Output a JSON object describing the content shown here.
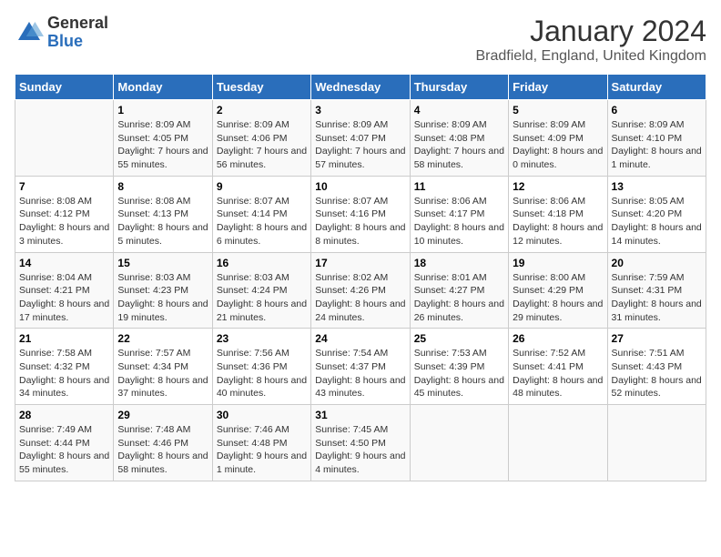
{
  "logo": {
    "general": "General",
    "blue": "Blue"
  },
  "title": "January 2024",
  "location": "Bradfield, England, United Kingdom",
  "days_of_week": [
    "Sunday",
    "Monday",
    "Tuesday",
    "Wednesday",
    "Thursday",
    "Friday",
    "Saturday"
  ],
  "weeks": [
    [
      {
        "day": "",
        "sunrise": "",
        "sunset": "",
        "daylight": ""
      },
      {
        "day": "1",
        "sunrise": "Sunrise: 8:09 AM",
        "sunset": "Sunset: 4:05 PM",
        "daylight": "Daylight: 7 hours and 55 minutes."
      },
      {
        "day": "2",
        "sunrise": "Sunrise: 8:09 AM",
        "sunset": "Sunset: 4:06 PM",
        "daylight": "Daylight: 7 hours and 56 minutes."
      },
      {
        "day": "3",
        "sunrise": "Sunrise: 8:09 AM",
        "sunset": "Sunset: 4:07 PM",
        "daylight": "Daylight: 7 hours and 57 minutes."
      },
      {
        "day": "4",
        "sunrise": "Sunrise: 8:09 AM",
        "sunset": "Sunset: 4:08 PM",
        "daylight": "Daylight: 7 hours and 58 minutes."
      },
      {
        "day": "5",
        "sunrise": "Sunrise: 8:09 AM",
        "sunset": "Sunset: 4:09 PM",
        "daylight": "Daylight: 8 hours and 0 minutes."
      },
      {
        "day": "6",
        "sunrise": "Sunrise: 8:09 AM",
        "sunset": "Sunset: 4:10 PM",
        "daylight": "Daylight: 8 hours and 1 minute."
      }
    ],
    [
      {
        "day": "7",
        "sunrise": "Sunrise: 8:08 AM",
        "sunset": "Sunset: 4:12 PM",
        "daylight": "Daylight: 8 hours and 3 minutes."
      },
      {
        "day": "8",
        "sunrise": "Sunrise: 8:08 AM",
        "sunset": "Sunset: 4:13 PM",
        "daylight": "Daylight: 8 hours and 5 minutes."
      },
      {
        "day": "9",
        "sunrise": "Sunrise: 8:07 AM",
        "sunset": "Sunset: 4:14 PM",
        "daylight": "Daylight: 8 hours and 6 minutes."
      },
      {
        "day": "10",
        "sunrise": "Sunrise: 8:07 AM",
        "sunset": "Sunset: 4:16 PM",
        "daylight": "Daylight: 8 hours and 8 minutes."
      },
      {
        "day": "11",
        "sunrise": "Sunrise: 8:06 AM",
        "sunset": "Sunset: 4:17 PM",
        "daylight": "Daylight: 8 hours and 10 minutes."
      },
      {
        "day": "12",
        "sunrise": "Sunrise: 8:06 AM",
        "sunset": "Sunset: 4:18 PM",
        "daylight": "Daylight: 8 hours and 12 minutes."
      },
      {
        "day": "13",
        "sunrise": "Sunrise: 8:05 AM",
        "sunset": "Sunset: 4:20 PM",
        "daylight": "Daylight: 8 hours and 14 minutes."
      }
    ],
    [
      {
        "day": "14",
        "sunrise": "Sunrise: 8:04 AM",
        "sunset": "Sunset: 4:21 PM",
        "daylight": "Daylight: 8 hours and 17 minutes."
      },
      {
        "day": "15",
        "sunrise": "Sunrise: 8:03 AM",
        "sunset": "Sunset: 4:23 PM",
        "daylight": "Daylight: 8 hours and 19 minutes."
      },
      {
        "day": "16",
        "sunrise": "Sunrise: 8:03 AM",
        "sunset": "Sunset: 4:24 PM",
        "daylight": "Daylight: 8 hours and 21 minutes."
      },
      {
        "day": "17",
        "sunrise": "Sunrise: 8:02 AM",
        "sunset": "Sunset: 4:26 PM",
        "daylight": "Daylight: 8 hours and 24 minutes."
      },
      {
        "day": "18",
        "sunrise": "Sunrise: 8:01 AM",
        "sunset": "Sunset: 4:27 PM",
        "daylight": "Daylight: 8 hours and 26 minutes."
      },
      {
        "day": "19",
        "sunrise": "Sunrise: 8:00 AM",
        "sunset": "Sunset: 4:29 PM",
        "daylight": "Daylight: 8 hours and 29 minutes."
      },
      {
        "day": "20",
        "sunrise": "Sunrise: 7:59 AM",
        "sunset": "Sunset: 4:31 PM",
        "daylight": "Daylight: 8 hours and 31 minutes."
      }
    ],
    [
      {
        "day": "21",
        "sunrise": "Sunrise: 7:58 AM",
        "sunset": "Sunset: 4:32 PM",
        "daylight": "Daylight: 8 hours and 34 minutes."
      },
      {
        "day": "22",
        "sunrise": "Sunrise: 7:57 AM",
        "sunset": "Sunset: 4:34 PM",
        "daylight": "Daylight: 8 hours and 37 minutes."
      },
      {
        "day": "23",
        "sunrise": "Sunrise: 7:56 AM",
        "sunset": "Sunset: 4:36 PM",
        "daylight": "Daylight: 8 hours and 40 minutes."
      },
      {
        "day": "24",
        "sunrise": "Sunrise: 7:54 AM",
        "sunset": "Sunset: 4:37 PM",
        "daylight": "Daylight: 8 hours and 43 minutes."
      },
      {
        "day": "25",
        "sunrise": "Sunrise: 7:53 AM",
        "sunset": "Sunset: 4:39 PM",
        "daylight": "Daylight: 8 hours and 45 minutes."
      },
      {
        "day": "26",
        "sunrise": "Sunrise: 7:52 AM",
        "sunset": "Sunset: 4:41 PM",
        "daylight": "Daylight: 8 hours and 48 minutes."
      },
      {
        "day": "27",
        "sunrise": "Sunrise: 7:51 AM",
        "sunset": "Sunset: 4:43 PM",
        "daylight": "Daylight: 8 hours and 52 minutes."
      }
    ],
    [
      {
        "day": "28",
        "sunrise": "Sunrise: 7:49 AM",
        "sunset": "Sunset: 4:44 PM",
        "daylight": "Daylight: 8 hours and 55 minutes."
      },
      {
        "day": "29",
        "sunrise": "Sunrise: 7:48 AM",
        "sunset": "Sunset: 4:46 PM",
        "daylight": "Daylight: 8 hours and 58 minutes."
      },
      {
        "day": "30",
        "sunrise": "Sunrise: 7:46 AM",
        "sunset": "Sunset: 4:48 PM",
        "daylight": "Daylight: 9 hours and 1 minute."
      },
      {
        "day": "31",
        "sunrise": "Sunrise: 7:45 AM",
        "sunset": "Sunset: 4:50 PM",
        "daylight": "Daylight: 9 hours and 4 minutes."
      },
      {
        "day": "",
        "sunrise": "",
        "sunset": "",
        "daylight": ""
      },
      {
        "day": "",
        "sunrise": "",
        "sunset": "",
        "daylight": ""
      },
      {
        "day": "",
        "sunrise": "",
        "sunset": "",
        "daylight": ""
      }
    ]
  ]
}
